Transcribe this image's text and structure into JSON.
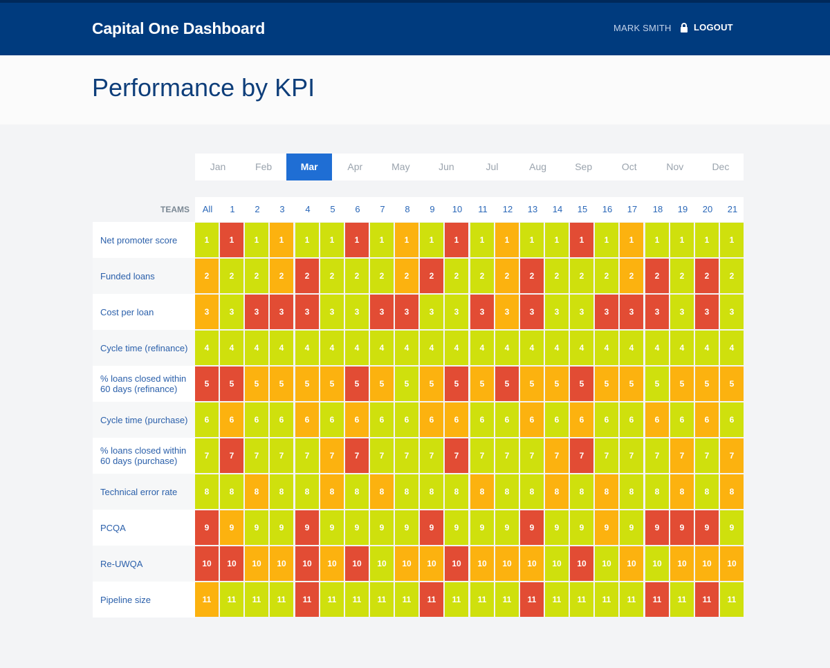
{
  "header": {
    "brand": "Capital One Dashboard",
    "user": "MARK SMITH",
    "logout_label": "LOGOUT",
    "logout_icon": "lock-icon"
  },
  "page": {
    "title": "Performance by KPI"
  },
  "months": {
    "items": [
      "Jan",
      "Feb",
      "Mar",
      "Apr",
      "May",
      "Jun",
      "Jul",
      "Aug",
      "Sep",
      "Oct",
      "Nov",
      "Dec"
    ],
    "selected": "Mar"
  },
  "grid": {
    "teams_label": "TEAMS",
    "teams": [
      "All",
      "1",
      "2",
      "3",
      "4",
      "5",
      "6",
      "7",
      "8",
      "9",
      "10",
      "11",
      "12",
      "13",
      "14",
      "15",
      "16",
      "17",
      "18",
      "19",
      "20",
      "21"
    ],
    "status_colors": {
      "G": "#cfe00d",
      "Y": "#fcb20f",
      "R": "#e24c34"
    },
    "rows": [
      {
        "label": "Net promoter score",
        "value": "1",
        "statuses": "GRGYGGRGYGRGYGGRGYGGGG"
      },
      {
        "label": "Funded loans",
        "value": "2",
        "statuses": "YGGYRGGGYRGGYRGGGYRGRG"
      },
      {
        "label": "Cost per loan",
        "value": "3",
        "statuses": "YGRRRGGRRGGRYRGGRRRGRG"
      },
      {
        "label": "Cycle time (refinance)",
        "value": "4",
        "statuses": "GGGGGGGGGGGGGGGGGGGGGG"
      },
      {
        "label": "% loans closed within 60 days (refinance)",
        "value": "5",
        "statuses": "RRYYYYRYGYRYRYYRYYGYYY"
      },
      {
        "label": "Cycle time (purchase)",
        "value": "6",
        "statuses": "GYGGYGYGGYYGGYGYGGYGYG"
      },
      {
        "label": "% loans closed within 60 days (purchase)",
        "value": "7",
        "statuses": "GRGGGYRGGGRGGGYRGGGYGY"
      },
      {
        "label": "Technical error rate",
        "value": "8",
        "statuses": "GGYGGYGYGGGYGGYGYGGYGY"
      },
      {
        "label": "PCQA",
        "value": "9",
        "statuses": "RYGGRGGGGRGGGRGGYGRRRG"
      },
      {
        "label": "Re-UWQA",
        "value": "10",
        "statuses": "RRYYRYRGYYRYYYGRGYGYYY"
      },
      {
        "label": "Pipeline size",
        "value": "11",
        "statuses": "YGGGRGGGGRGGGRGGGGRGRG"
      }
    ]
  }
}
